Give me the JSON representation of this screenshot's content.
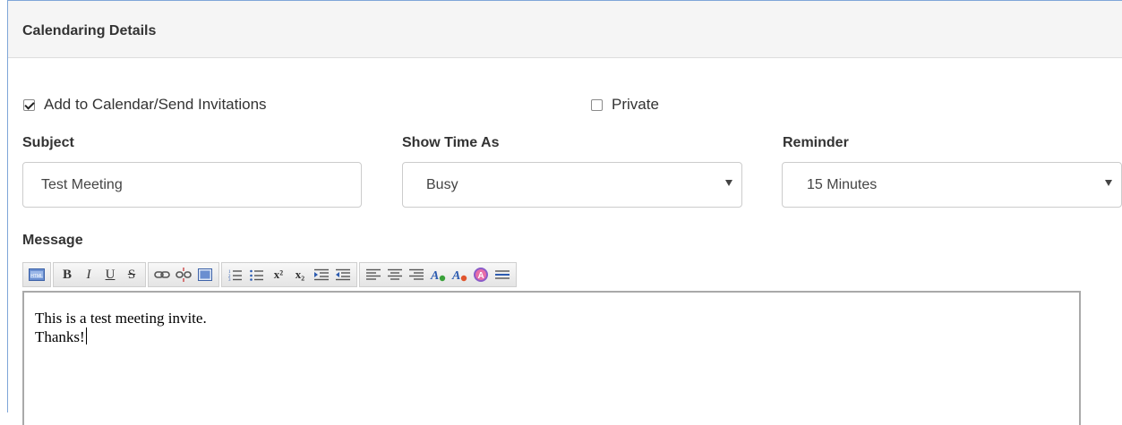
{
  "panel": {
    "title": "Calendaring Details"
  },
  "options": {
    "add_to_calendar": {
      "label": "Add to Calendar/Send Invitations",
      "checked": true
    },
    "private": {
      "label": "Private",
      "checked": false
    }
  },
  "subject": {
    "label": "Subject",
    "value": "Test Meeting"
  },
  "show_time_as": {
    "label": "Show Time As",
    "value": "Busy"
  },
  "reminder": {
    "label": "Reminder",
    "value": "15 Minutes"
  },
  "message": {
    "label": "Message",
    "lines": [
      "This is a test meeting invite.",
      "Thanks!"
    ],
    "toolbar": {
      "html": "HTML",
      "bold": "B",
      "italic": "I",
      "underline": "U",
      "strike": "S",
      "sup": "x²",
      "sub": "x₂"
    }
  },
  "colors": {
    "border_accent": "#7fa6d8",
    "header_bg": "#f5f5f5"
  }
}
